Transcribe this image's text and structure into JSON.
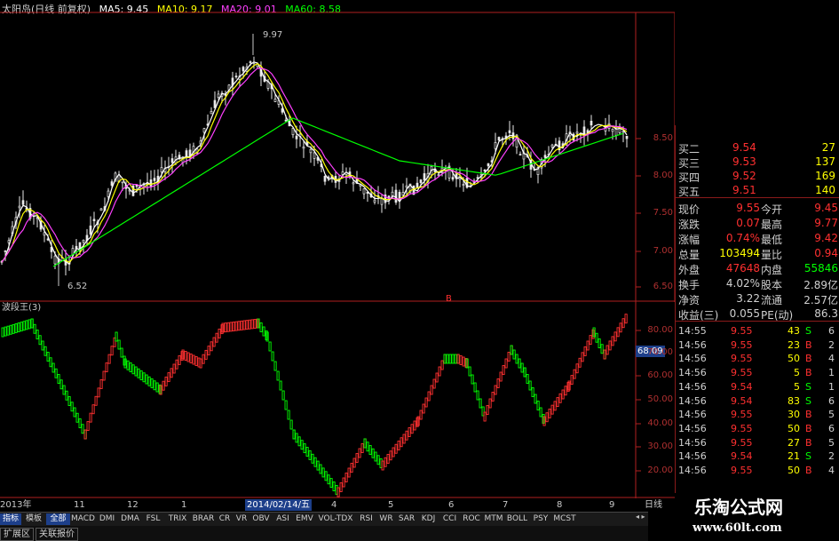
{
  "chart_header": {
    "title": "太阳岛(日线 前复权)",
    "ma5": "MA5: 9.45",
    "ma10": "MA10: 9.17",
    "ma20": "MA20: 9.01",
    "ma60": "MA60: 8.58"
  },
  "colors": {
    "up": "#ff3030",
    "down": "#00ff00",
    "axis": "#b02020",
    "ma5": "#ffffff",
    "ma10": "#ffff00",
    "ma20": "#ff40ff",
    "ma60": "#00ff00",
    "highlight": "#1d3f8a"
  },
  "main_chart": {
    "high_label": "9.97",
    "low_label": "6.52",
    "yticks": [
      "8.50",
      "8.00",
      "7.50",
      "7.00",
      "6.50"
    ]
  },
  "indicator": {
    "title": "波段王(3)",
    "marker": "B",
    "value_box": "68.09",
    "yticks": [
      "80.00",
      "70.00",
      "60.00",
      "50.00",
      "40.00",
      "30.00",
      "20.00"
    ]
  },
  "x_axis": {
    "labels": [
      "2013年",
      "11",
      "12",
      "1",
      "2014/02/14/五",
      "4",
      "5",
      "6",
      "7",
      "8",
      "9"
    ],
    "right_label": "日线"
  },
  "quote_panel": {
    "bids": [
      {
        "label": "买二",
        "price": "9.54",
        "vol": "27"
      },
      {
        "label": "买三",
        "price": "9.53",
        "vol": "137"
      },
      {
        "label": "买四",
        "price": "9.52",
        "vol": "169"
      },
      {
        "label": "买五",
        "price": "9.51",
        "vol": "140"
      }
    ],
    "stats": [
      {
        "l1": "现价",
        "v1": "9.55",
        "l2": "今开",
        "v2": "9.45"
      },
      {
        "l1": "涨跌",
        "v1": "0.07",
        "l2": "最高",
        "v2": "9.77"
      },
      {
        "l1": "涨幅",
        "v1": "0.74%",
        "l2": "最低",
        "v2": "9.42"
      },
      {
        "l1": "总量",
        "v1": "103494",
        "l2": "量比",
        "v2": "0.94"
      },
      {
        "l1": "外盘",
        "v1": "47648",
        "l2": "内盘",
        "v2": "55846"
      },
      {
        "l1": "换手",
        "v1": "4.02%",
        "l2": "股本",
        "v2": "2.89亿"
      },
      {
        "l1": "净资",
        "v1": "3.22",
        "l2": "流通",
        "v2": "2.57亿"
      },
      {
        "l1": "收益(三)",
        "v1": "0.055",
        "l2": "PE(动)",
        "v2": "86.3"
      }
    ],
    "trades": [
      {
        "time": "14:55",
        "price": "9.55",
        "vol": "43",
        "side": "S",
        "n": "6"
      },
      {
        "time": "14:56",
        "price": "9.55",
        "vol": "23",
        "side": "B",
        "n": "2"
      },
      {
        "time": "14:56",
        "price": "9.55",
        "vol": "50",
        "side": "B",
        "n": "4"
      },
      {
        "time": "14:56",
        "price": "9.55",
        "vol": "5",
        "side": "B",
        "n": "1"
      },
      {
        "time": "14:56",
        "price": "9.54",
        "vol": "5",
        "side": "S",
        "n": "1"
      },
      {
        "time": "14:56",
        "price": "9.54",
        "vol": "83",
        "side": "S",
        "n": "6"
      },
      {
        "time": "14:56",
        "price": "9.55",
        "vol": "30",
        "side": "B",
        "n": "5"
      },
      {
        "time": "14:56",
        "price": "9.55",
        "vol": "50",
        "side": "B",
        "n": "6"
      },
      {
        "time": "14:56",
        "price": "9.55",
        "vol": "27",
        "side": "B",
        "n": "5"
      },
      {
        "time": "14:56",
        "price": "9.54",
        "vol": "21",
        "side": "S",
        "n": "2"
      },
      {
        "time": "14:56",
        "price": "9.55",
        "vol": "50",
        "side": "B",
        "n": "4"
      }
    ]
  },
  "tabs": [
    "指标",
    "模板",
    "全部",
    "MACD",
    "DMI",
    "DMA",
    "FSL",
    "TRIX",
    "BRAR",
    "CR",
    "VR",
    "OBV",
    "ASI",
    "EMV",
    "VOL-TDX",
    "RSI",
    "WR",
    "SAR",
    "KDJ",
    "CCI",
    "ROC",
    "MTM",
    "BOLL",
    "PSY",
    "MCST"
  ],
  "bottom_buttons": [
    "扩展区",
    "关联报价"
  ],
  "watermark": {
    "title": "乐淘公式网",
    "url": "www.60lt.com"
  }
}
